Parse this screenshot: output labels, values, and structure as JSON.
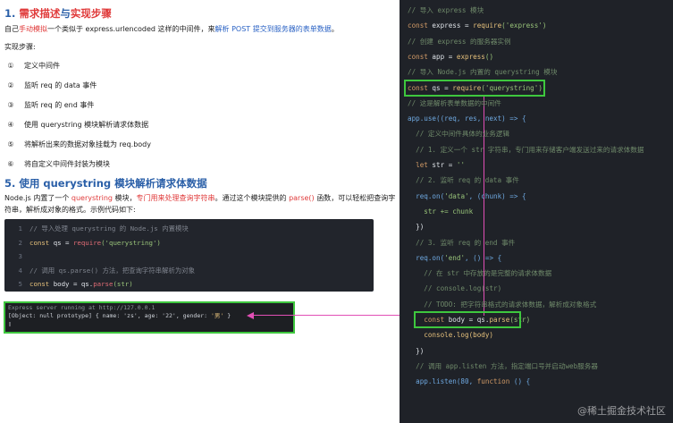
{
  "section1": {
    "num": "1.",
    "title_red": "需求描述",
    "title_mid": "与",
    "title_red2": "实现步骤"
  },
  "intro": {
    "pre": "自己",
    "red": "手动模拟",
    "mid": "一个类似于 express.urlencoded 这样的中间件，来",
    "blue": "解析 POST 提交到服务器的表单数据",
    "post": "。"
  },
  "steps_label": "实现步骤:",
  "steps": [
    {
      "num": "①",
      "text": "定义中间件"
    },
    {
      "num": "②",
      "text": "监听 req 的 data 事件"
    },
    {
      "num": "③",
      "text": "监听 req 的 end 事件"
    },
    {
      "num": "④",
      "text": "使用 querystring 模块解析请求体数据"
    },
    {
      "num": "⑤",
      "text": "将解析出来的数据对象挂载为 req.body"
    },
    {
      "num": "⑥",
      "text": "将自定义中间件封装为模块"
    }
  ],
  "section5": {
    "title": "5. 使用 querystring 模块解析请求体数据"
  },
  "para5": {
    "a": "Node.js 内置了一个 ",
    "red1": "querystring",
    "b": " 模块，",
    "red2": "专门用来处理查询字符串",
    "c": "。通过这个模块提供的 ",
    "red3": "parse()",
    "d": " 函数，可以轻松把查询字符串，解析成对象的格式。示例代码如下:"
  },
  "code": {
    "l1": {
      "n": "1",
      "c": "// 导入处理 querystring 的 Node.js 内置模块"
    },
    "l2": {
      "n": "2",
      "k": "const",
      "v": " qs = ",
      "f": "require",
      "s": "('querystring')"
    },
    "l3": {
      "n": "3"
    },
    "l4": {
      "n": "4",
      "c": "// 调用 qs.parse() 方法，把查询字符串解析为对象"
    },
    "l5": {
      "n": "5",
      "k": "const",
      "v": " body = qs.",
      "f": "parse",
      "s": "(str)"
    }
  },
  "terminal": {
    "line1": "Express server running at http://127.0.0.1",
    "line2a": "[Object: null prototype] { name: 'zs', age: '22', gender: ",
    "line2b": "'男'",
    "line2c": " }",
    "line3": "▯"
  },
  "editor": {
    "e1": "// 导入 express 模块",
    "e2k": "const",
    "e2v": " express = ",
    "e2f": "require",
    "e2s": "('express')",
    "e3": "// 创建 express 的服务器实例",
    "e4k": "const",
    "e4v": " app = ",
    "e4f": "express",
    "e4s": "()",
    "e5": "// 导入 Node.js 内置的 querystring 模块",
    "e6k": "const",
    "e6v": " qs = ",
    "e6f": "require",
    "e6s": "('querystring')",
    "e7": "// 这是解析表单数据的中间件",
    "e8": "app.use((req, res, next) => {",
    "e9": "  // 定义中间件具体的业务逻辑",
    "e10": "  // 1. 定义一个 str 字符串，专门用来存储客户端发送过来的请求体数据",
    "e11k": "  let",
    "e11v": " str = ",
    "e11s": "''",
    "e12": "  // 2. 监听 req 的 data 事件",
    "e13a": "  req.on(",
    "e13s": "'data'",
    "e13b": ", (chunk) => {",
    "e14": "    str += chunk",
    "e15": "  })",
    "e16": "  // 3. 监听 req 的 end 事件",
    "e17a": "  req.on(",
    "e17s": "'end'",
    "e17b": ", () => {",
    "e18": "    // 在 str 中存放的是完整的请求体数据",
    "e19": "    // console.log(str)",
    "e20": "    // TODO: 把字符串格式的请求体数据，解析成对象格式",
    "e21k": "    const",
    "e21v": " body = qs.",
    "e21f": "parse",
    "e21s": "(str)",
    "e22": "    console.log(body)",
    "e23": "  })",
    "e24": "  // 调用 app.listen 方法，指定端口号并启动web服务器",
    "e25a": "  app.listen(80, ",
    "e25k": "function",
    "e25b": " () {",
    "e26a": "    console.log(",
    "e26s": "'Express server running at http://127.0.0.1'",
    "e26b": ")",
    "e27": "  })"
  },
  "watermark": "@稀土掘金技术社区",
  "colors": {
    "highlight_green": "#3ec73e",
    "arrow_pink": "#e14fb5",
    "editor_bg": "#1f2228",
    "heading_blue": "#2a5fa8",
    "emphasis_red": "#e03b3b"
  }
}
